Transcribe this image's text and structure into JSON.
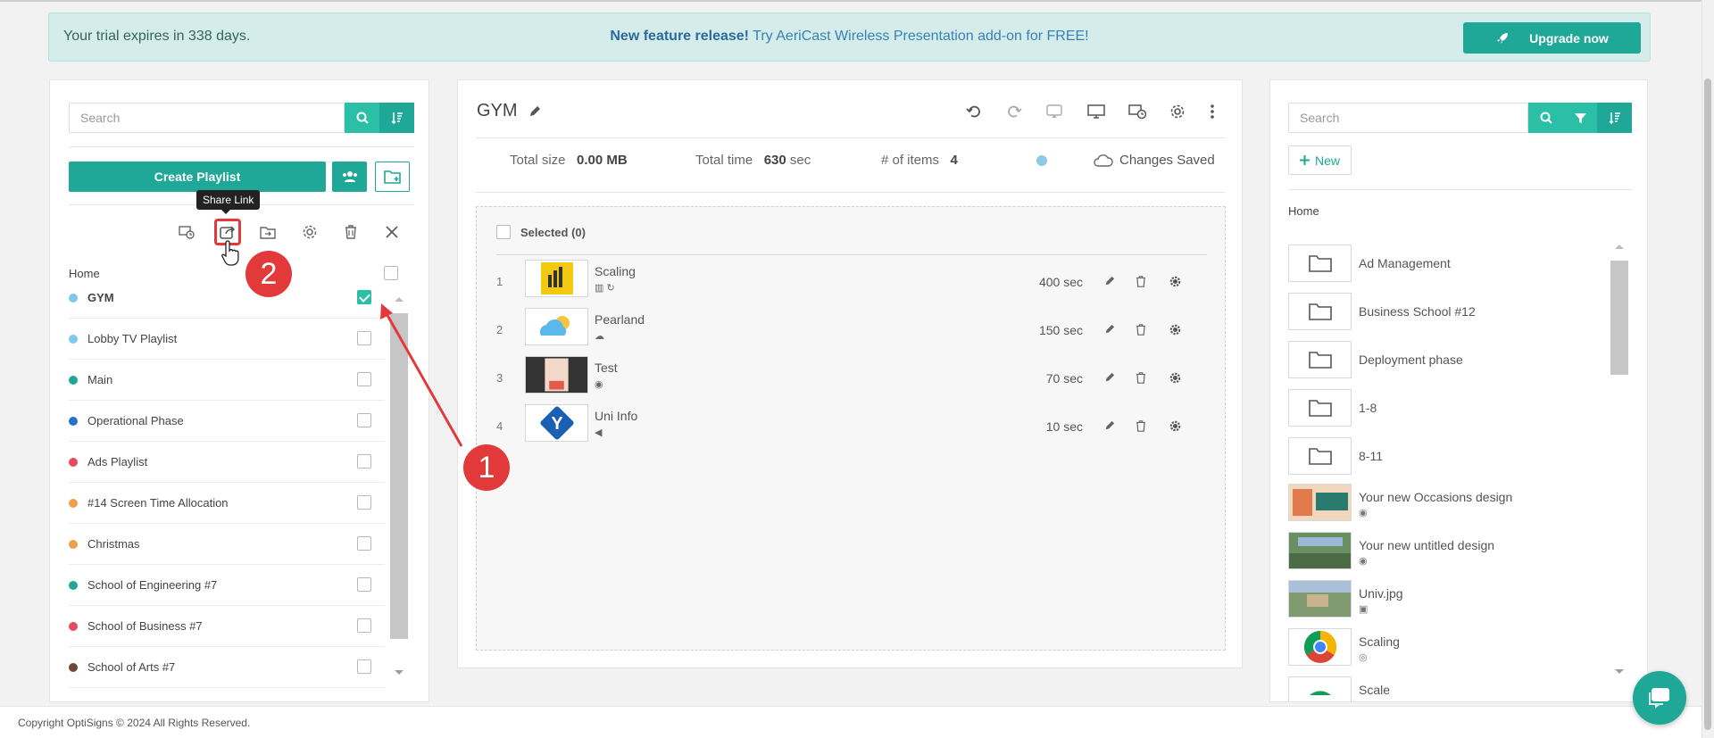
{
  "banner": {
    "trial_text": "Your trial expires in 338 days.",
    "promo_bold": "New feature release!",
    "promo_text": "Try AeriCast Wireless Presentation add-on for FREE!",
    "upgrade_label": "Upgrade now"
  },
  "left": {
    "search_placeholder": "Search",
    "create_label": "Create Playlist",
    "tooltip": "Share Link",
    "home_label": "Home",
    "items": [
      {
        "name": "GYM",
        "color": "#7fc7ee",
        "checked": true
      },
      {
        "name": "Lobby TV Playlist",
        "color": "#7fc7ee",
        "checked": false
      },
      {
        "name": "Main",
        "color": "#1fa797",
        "checked": false
      },
      {
        "name": "Operational Phase",
        "color": "#2472c8",
        "checked": false
      },
      {
        "name": "Ads Playlist",
        "color": "#e84a5f",
        "checked": false
      },
      {
        "name": "#14 Screen Time Allocation",
        "color": "#f0a04b",
        "checked": false
      },
      {
        "name": "Christmas",
        "color": "#f0a04b",
        "checked": false
      },
      {
        "name": "School of Engineering #7",
        "color": "#1fa797",
        "checked": false
      },
      {
        "name": "School of Business #7",
        "color": "#e84a5f",
        "checked": false
      },
      {
        "name": "School of Arts #7",
        "color": "#6b4a3a",
        "checked": false
      }
    ]
  },
  "middle": {
    "title": "GYM",
    "total_size_label": "Total size",
    "total_size_value": "0.00 MB",
    "total_time_label": "Total time",
    "total_time_value": "630",
    "total_time_unit": "sec",
    "items_label": "# of items",
    "items_value": "4",
    "saved_label": "Changes Saved",
    "selected_label": "Selected (0)",
    "playlist": [
      {
        "num": "1",
        "name": "Scaling",
        "duration": "400 sec"
      },
      {
        "num": "2",
        "name": "Pearland",
        "duration": "150 sec"
      },
      {
        "num": "3",
        "name": "Test",
        "duration": "70 sec"
      },
      {
        "num": "4",
        "name": "Uni Info",
        "duration": "10 sec"
      }
    ]
  },
  "right": {
    "search_placeholder": "Search",
    "new_label": "New",
    "home_label": "Home",
    "items": [
      {
        "name": "Ad Management",
        "type": "folder"
      },
      {
        "name": "Business School #12",
        "type": "folder"
      },
      {
        "name": "Deployment phase",
        "type": "folder"
      },
      {
        "name": "1-8",
        "type": "folder"
      },
      {
        "name": "8-11",
        "type": "folder"
      },
      {
        "name": "Your new Occasions design",
        "type": "design"
      },
      {
        "name": "Your new untitled design",
        "type": "design"
      },
      {
        "name": "Univ.jpg",
        "type": "image"
      },
      {
        "name": "Scaling",
        "type": "web"
      },
      {
        "name": "Scale",
        "type": "web"
      }
    ]
  },
  "footer": {
    "copyright": "Copyright OptiSigns © 2024 All Rights Reserved."
  },
  "annotations": {
    "one": "1",
    "two": "2"
  },
  "colors": {
    "accent": "#1fa797",
    "accent_light": "#2bbfa7",
    "annotation": "#e23a3a"
  }
}
